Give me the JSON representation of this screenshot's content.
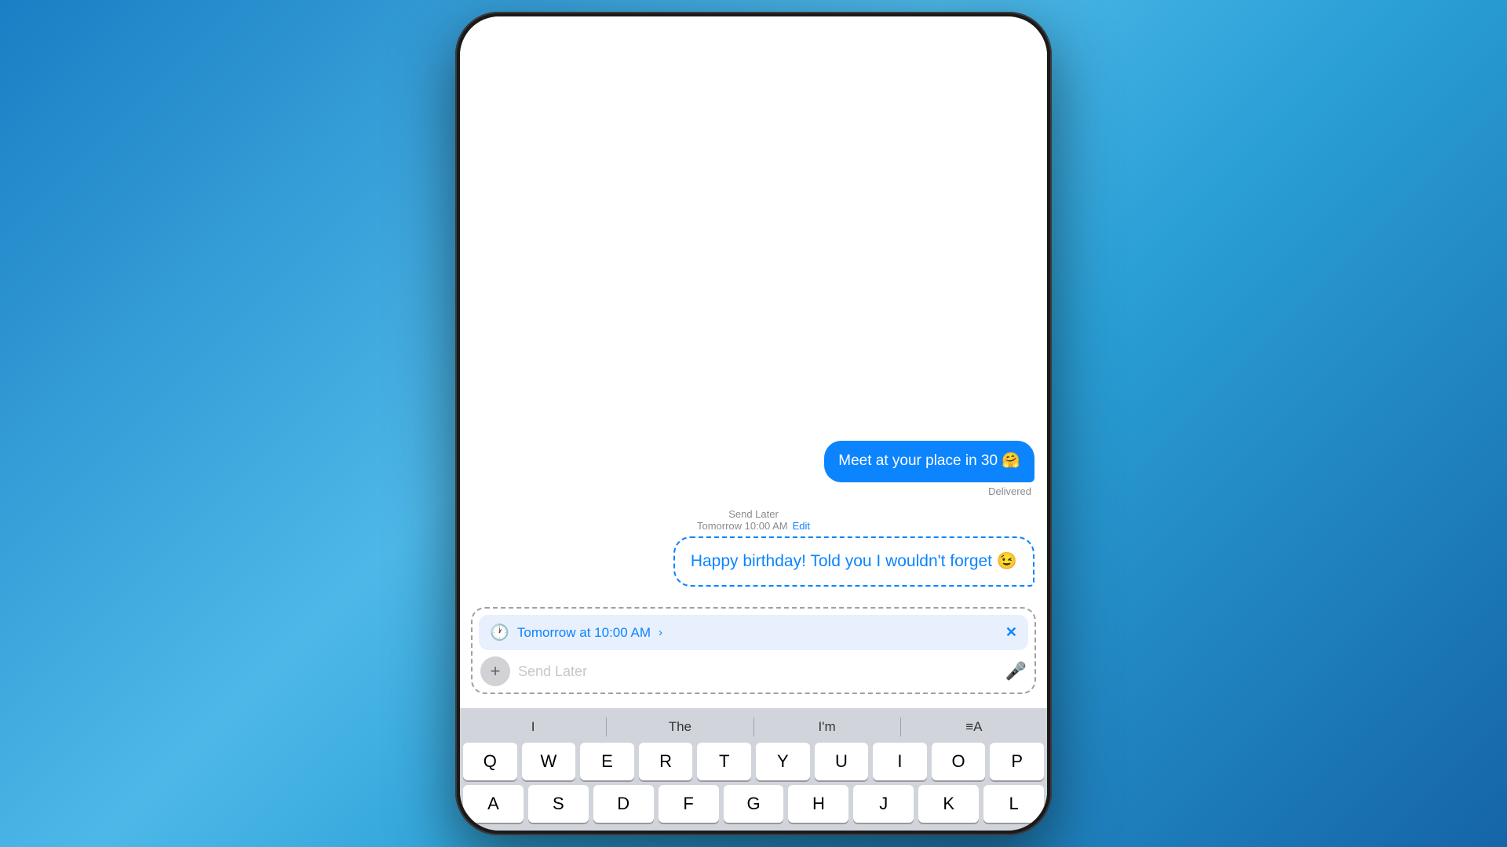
{
  "messages": {
    "sent_message": {
      "text": "Meet at your place in 30 🤗",
      "status": "Delivered"
    },
    "send_later_label": "Send Later",
    "send_later_time": "Tomorrow 10:00 AM",
    "send_later_edit": "Edit",
    "scheduled_message": {
      "text": "Happy birthday! Told you I wouldn't forget 😉"
    }
  },
  "input_area": {
    "schedule_bar": {
      "time": "Tomorrow at 10:00 AM",
      "chevron": "›"
    },
    "text_input_placeholder": "Send Later",
    "plus_label": "+",
    "close_label": "✕"
  },
  "keyboard": {
    "suggestions": [
      "I",
      "The",
      "I'm",
      "≡A"
    ],
    "rows": [
      [
        "Q",
        "W",
        "E",
        "R",
        "T",
        "Y",
        "U",
        "I",
        "O",
        "P"
      ],
      [
        "A",
        "S",
        "D",
        "F",
        "G",
        "H",
        "J",
        "K",
        "L"
      ]
    ]
  }
}
